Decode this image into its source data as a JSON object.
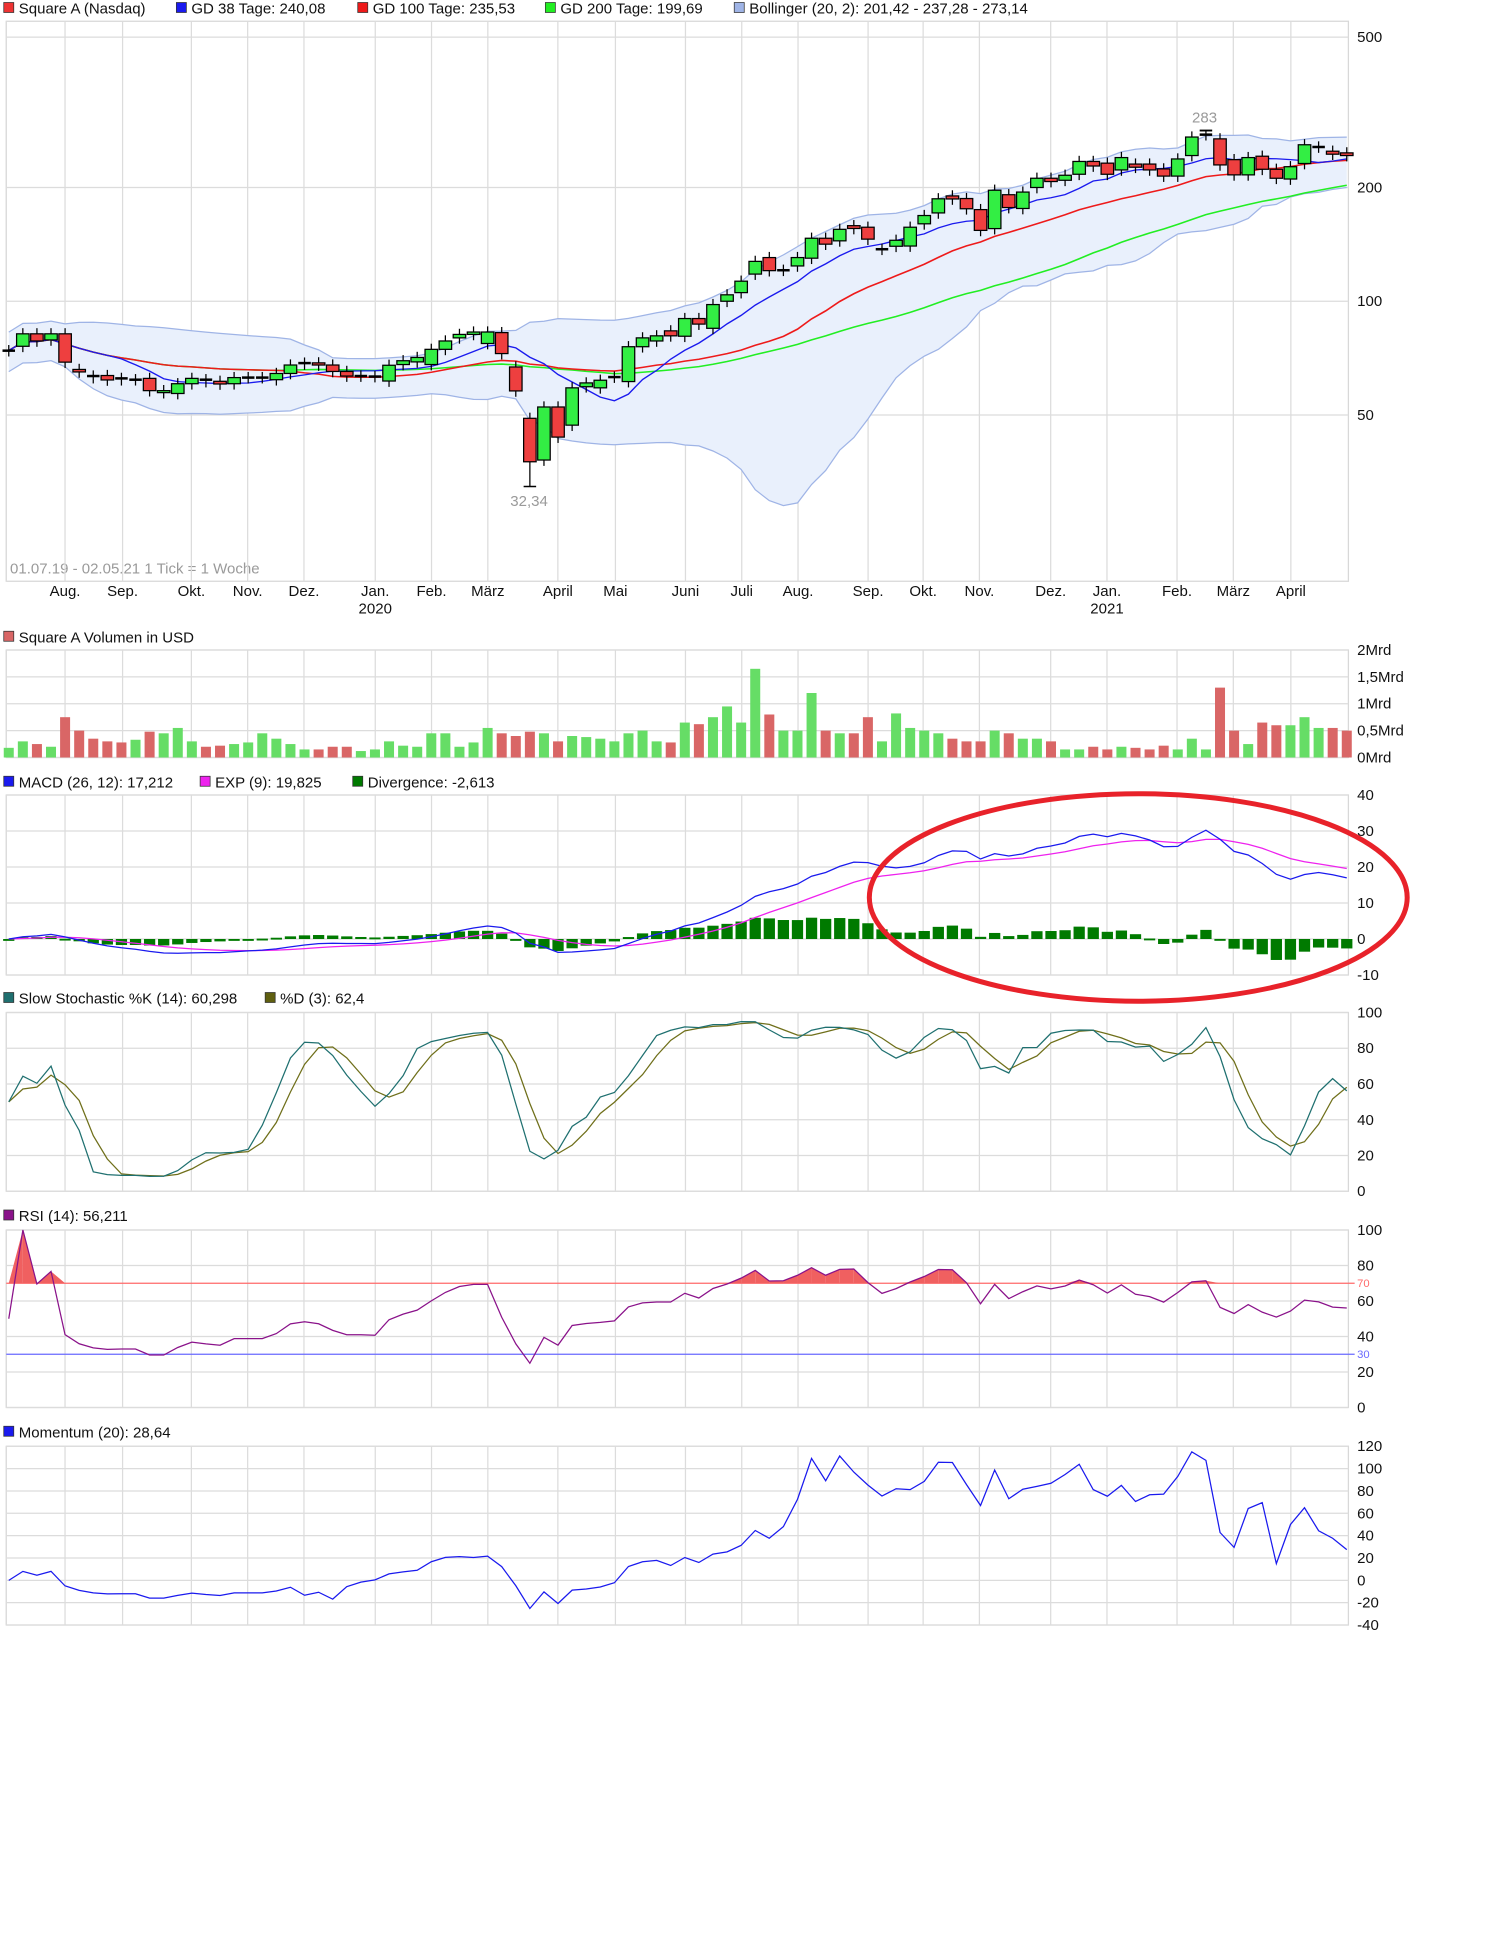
{
  "chart_data": [
    {
      "type": "candlestick",
      "title": "Square A (Nasdaq)",
      "legend": [
        {
          "label": "Square A (Nasdaq)",
          "color": "#ee3333"
        },
        {
          "label": "GD 38 Tage: 240,08",
          "color": "#1a1aee"
        },
        {
          "label": "GD 100 Tage: 235,53",
          "color": "#ee1a1a"
        },
        {
          "label": "GD 200 Tage: 199,69",
          "color": "#22ee22"
        },
        {
          "label": "Bollinger (20, 2): 201,42 - 237,28 - 273,14",
          "color": "#9fb4e6"
        }
      ],
      "period_note": "01.07.19 - 02.05.21   1 Tick = 1 Woche",
      "y_scale": "log",
      "y_ticks": [
        "500",
        "200",
        "100",
        "50"
      ],
      "y_tick_values": [
        500,
        200,
        100,
        50
      ],
      "x_months": [
        "Aug.",
        "Sep.",
        "Okt.",
        "Nov.",
        "Dez.",
        "Jan.",
        "Feb.",
        "März",
        "April",
        "Mai",
        "Juni",
        "Juli",
        "Aug.",
        "Sep.",
        "Okt.",
        "Nov.",
        "Dez.",
        "Jan.",
        "Feb.",
        "März",
        "April"
      ],
      "x_years": [
        {
          "label": "2020",
          "month_index": 5
        },
        {
          "label": "2021",
          "month_index": 17
        }
      ],
      "annotations": {
        "high_label": "283",
        "high_value": 283,
        "high_index": 85,
        "low_label": "32,34",
        "low_value": 32.34,
        "low_index": 37
      },
      "wick_pct": 3.5,
      "candles_open_close": [
        [
          74,
          74
        ],
        [
          76,
          82
        ],
        [
          82,
          78.5
        ],
        [
          79,
          82
        ],
        [
          82,
          69
        ],
        [
          66,
          65
        ],
        [
          63.4,
          62.8
        ],
        [
          63.6,
          61.9
        ],
        [
          62.5,
          62
        ],
        [
          62,
          62
        ],
        [
          62.5,
          58
        ],
        [
          57.3,
          58
        ],
        [
          57,
          60.5
        ],
        [
          60.5,
          62.5
        ],
        [
          62,
          61.3
        ],
        [
          61.4,
          60.4
        ],
        [
          60.5,
          62.8
        ],
        [
          62.8,
          62.8
        ],
        [
          62.8,
          62.8
        ],
        [
          62,
          64.4
        ],
        [
          64.4,
          67.8
        ],
        [
          68.2,
          68.6
        ],
        [
          68.7,
          67.8
        ],
        [
          67.8,
          65.2
        ],
        [
          65.2,
          63.4
        ],
        [
          63.4,
          63.4
        ],
        [
          63.2,
          63.2
        ],
        [
          61.5,
          67.7
        ],
        [
          68,
          69.6
        ],
        [
          69.1,
          71
        ],
        [
          68,
          74.6
        ],
        [
          74.6,
          78.5
        ],
        [
          80,
          81.7
        ],
        [
          81.7,
          82.9
        ],
        [
          77.3,
          82.9
        ],
        [
          82.6,
          72.7
        ],
        [
          67,
          57.9
        ],
        [
          49,
          37.6
        ],
        [
          38,
          52.5
        ],
        [
          52.5,
          43.7
        ],
        [
          47,
          59
        ],
        [
          59.4,
          60.8
        ],
        [
          59,
          61.8
        ],
        [
          63,
          63
        ],
        [
          61.3,
          75.8
        ],
        [
          75.8,
          80
        ],
        [
          78.5,
          81
        ],
        [
          83.5,
          81
        ],
        [
          80.8,
          90
        ],
        [
          90,
          87
        ],
        [
          84.8,
          98
        ],
        [
          100,
          104
        ],
        [
          105.4,
          113
        ],
        [
          118,
          127.5
        ],
        [
          130.5,
          120.5
        ],
        [
          120.8,
          120.8
        ],
        [
          124,
          130.5
        ],
        [
          130,
          146.8
        ],
        [
          146.8,
          141.6
        ],
        [
          144.5,
          155
        ],
        [
          158.5,
          155.8
        ],
        [
          157,
          146
        ],
        [
          137.3,
          137.3
        ],
        [
          139.8,
          145
        ],
        [
          140,
          157
        ],
        [
          160.3,
          168.6
        ],
        [
          171.3,
          186.7
        ],
        [
          190,
          186.5
        ],
        [
          187,
          175.7
        ],
        [
          174.8,
          154
        ],
        [
          155.7,
          196.7
        ],
        [
          191.4,
          177
        ],
        [
          176,
          194.5
        ],
        [
          200,
          211.6
        ],
        [
          211.6,
          207.4
        ],
        [
          209,
          215.5
        ],
        [
          216.8,
          234.4
        ],
        [
          234.4,
          228
        ],
        [
          232,
          216.8
        ],
        [
          222.6,
          240
        ],
        [
          230.7,
          226.3
        ],
        [
          230.7,
          222.6
        ],
        [
          224,
          214.4
        ],
        [
          214.4,
          238
        ],
        [
          243,
          272
        ],
        [
          276,
          276
        ],
        [
          269,
          229.5
        ],
        [
          237,
          216
        ],
        [
          216,
          240
        ],
        [
          242,
          223.5
        ],
        [
          223.5,
          211.6
        ],
        [
          210.6,
          227
        ],
        [
          231.5,
          259.5
        ],
        [
          256,
          256
        ],
        [
          249.5,
          245
        ],
        [
          247,
          243
        ]
      ],
      "moving_average_periods_weeks": {
        "gd38": 8,
        "gd100": 20,
        "gd200": 40,
        "bollinger": 20,
        "bollinger_k": 2
      }
    },
    {
      "type": "bar",
      "title": "Square A Volumen in USD",
      "legend_color": "#d96666",
      "unit": "Mrd",
      "y_ticks": [
        "2Mrd",
        "1,5Mrd",
        "1Mrd",
        "0,5Mrd",
        "0Mrd"
      ],
      "y_tick_values": [
        2,
        1.5,
        1,
        0.5,
        0
      ],
      "values": [
        0.18,
        0.3,
        0.25,
        0.2,
        0.75,
        0.5,
        0.35,
        0.3,
        0.28,
        0.33,
        0.48,
        0.45,
        0.55,
        0.3,
        0.2,
        0.22,
        0.25,
        0.28,
        0.45,
        0.35,
        0.25,
        0.15,
        0.15,
        0.2,
        0.2,
        0.12,
        0.15,
        0.3,
        0.22,
        0.2,
        0.45,
        0.45,
        0.2,
        0.28,
        0.55,
        0.45,
        0.4,
        0.48,
        0.45,
        0.3,
        0.4,
        0.38,
        0.35,
        0.3,
        0.45,
        0.5,
        0.3,
        0.28,
        0.65,
        0.62,
        0.75,
        0.95,
        0.65,
        1.65,
        0.8,
        0.5,
        0.5,
        1.2,
        0.5,
        0.45,
        0.45,
        0.75,
        0.3,
        0.82,
        0.55,
        0.5,
        0.45,
        0.35,
        0.3,
        0.3,
        0.5,
        0.45,
        0.35,
        0.35,
        0.3,
        0.15,
        0.15,
        0.2,
        0.15,
        0.2,
        0.18,
        0.15,
        0.22,
        0.15,
        0.35,
        0.15,
        1.3,
        0.5,
        0.25,
        0.65,
        0.6,
        0.6,
        0.75,
        0.55,
        0.55,
        0.5
      ],
      "up_color": "#66dd66",
      "down_color": "#d96666"
    },
    {
      "type": "line",
      "title": "MACD",
      "legend": [
        {
          "label": "MACD (26, 12): 17,212",
          "color": "#1a1aee"
        },
        {
          "label": "EXP (9): 19,825",
          "color": "#ee22ee"
        },
        {
          "label": "Divergence: -2,613",
          "color": "#007a00"
        }
      ],
      "y_ticks": [
        "40",
        "30",
        "20",
        "10",
        "0",
        "-10"
      ],
      "ylim": [
        -10,
        40
      ],
      "highlight": {
        "shape": "ellipse",
        "color": "#e8222a"
      }
    },
    {
      "type": "line",
      "title": "Slow Stochastic",
      "legend": [
        {
          "label": "Slow Stochastic %K (14): 60,298",
          "color": "#1f6f6f"
        },
        {
          "label": "%D (3): 62,4",
          "color": "#5f5f10"
        }
      ],
      "y_ticks": [
        "100",
        "80",
        "60",
        "40",
        "20",
        "0"
      ],
      "ylim": [
        0,
        100
      ]
    },
    {
      "type": "line",
      "title": "RSI",
      "legend": [
        {
          "label": "RSI (14): 56,211",
          "color": "#8a128a"
        }
      ],
      "y_ticks": [
        "100",
        "80",
        "60",
        "40",
        "20",
        "0"
      ],
      "ylim": [
        0,
        100
      ],
      "levels": [
        {
          "label": "70",
          "value": 70,
          "color": "#ff6a6a"
        },
        {
          "label": "30",
          "value": 30,
          "color": "#6a6aff"
        }
      ]
    },
    {
      "type": "line",
      "title": "Momentum",
      "legend": [
        {
          "label": "Momentum (20): 28,64",
          "color": "#1a1aee"
        }
      ],
      "y_ticks": [
        "120",
        "100",
        "80",
        "60",
        "40",
        "20",
        "0",
        "-20",
        "-40"
      ],
      "ylim": [
        -40,
        120
      ]
    }
  ]
}
